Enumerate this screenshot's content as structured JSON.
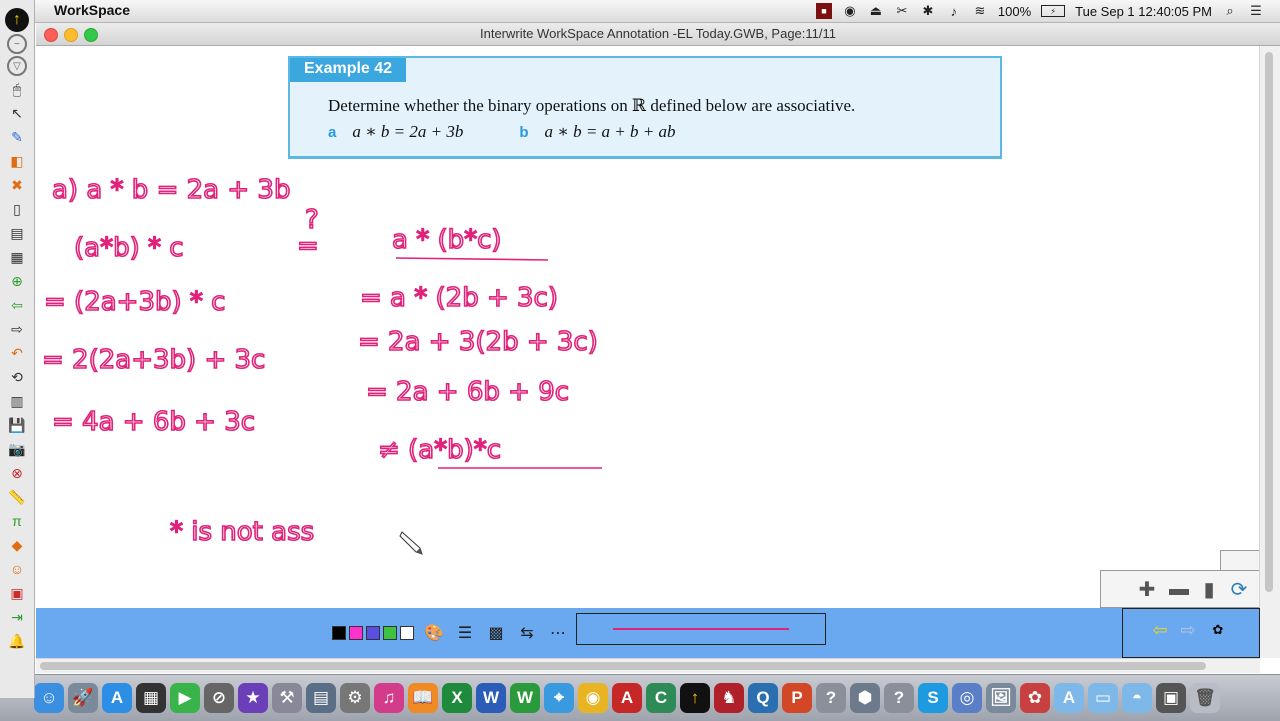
{
  "menubar": {
    "app_name": "WorkSpace",
    "battery": "100%",
    "datetime": "Tue Sep 1  12:40:05 PM"
  },
  "window": {
    "title": "Interwrite WorkSpace Annotation -EL Today.GWB, Page:11/11"
  },
  "example": {
    "label": "Example 42",
    "text": "Determine whether the binary operations on ℝ defined below are associative.",
    "part_a_tag": "a",
    "part_a": "a ∗ b = 2a + 3b",
    "part_b_tag": "b",
    "part_b": "a ∗ b = a + b + ab"
  },
  "ink": {
    "color": "#e0227a",
    "lines": [
      "a)  a * b  =  2a + 3b",
      "(a*b) * c",
      "?",
      "=",
      "a * (b*c)",
      "= (2a+3b) * c",
      "= a * (2b + 3c)",
      "= 2(2a+3b) + 3c",
      "= 2a + 3(2b + 3c)",
      "= 2a + 6b + 9c",
      "= 4a + 6b + 3c",
      "≠ (a*b)*c",
      "* is not ass"
    ]
  },
  "bottombar": {
    "swatches": [
      "#000000",
      "#ff33cc",
      "#5a4fe0",
      "#3fc23f",
      "#ffffff"
    ],
    "pen_color": "#e0227a"
  },
  "colors": {
    "toolbar_bg": "#e9e9e9",
    "bottom_bar": "#6aa8ef",
    "example_bg": "#e4f3fb",
    "example_border": "#5cb7e4"
  }
}
